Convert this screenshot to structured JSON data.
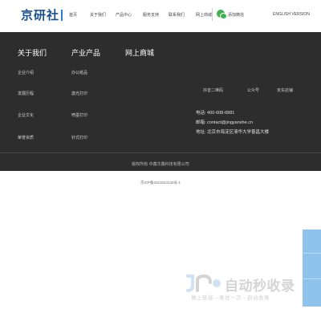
{
  "header": {
    "logo_text": "京研社",
    "nav": [
      "首页",
      "关于我们",
      "产品中心",
      "服务支持",
      "联系我们",
      "网上商城"
    ],
    "wechat_label": "添加微信",
    "language": "ENGLISH VERSION"
  },
  "footer": {
    "columns": [
      {
        "title": "关于我们",
        "links": [
          "企业介绍",
          "发展历程",
          "企业文化",
          "荣誉资质"
        ]
      },
      {
        "title": "产业产品",
        "links": [
          "办公纸品",
          "激光打印",
          "喷墨打印",
          "针式打印"
        ]
      },
      {
        "title": "网上商城",
        "links": []
      }
    ],
    "qr_labels": [
      "抖音二维码",
      "公众号",
      "京东店铺"
    ],
    "contact": {
      "phone": "电话: 400-608-6881",
      "email": "邮箱: contact@jingyanshe.cn",
      "address": "地址: 北京市海淀区清华大学善昌大楼"
    },
    "copyright": "版权所有 中鑫华鑫科技有限公司"
  },
  "icp": "京ICP备2021024134号-1",
  "watermark": {
    "title": "自动秒收录",
    "subtitle": "做上链接→来访一次→自动收录"
  },
  "colors": {
    "footer_bg": "#2d2d2d",
    "accent": "#1a4f8f",
    "wechat": "#3fb34f",
    "side_bar": "#8fc3ec"
  }
}
